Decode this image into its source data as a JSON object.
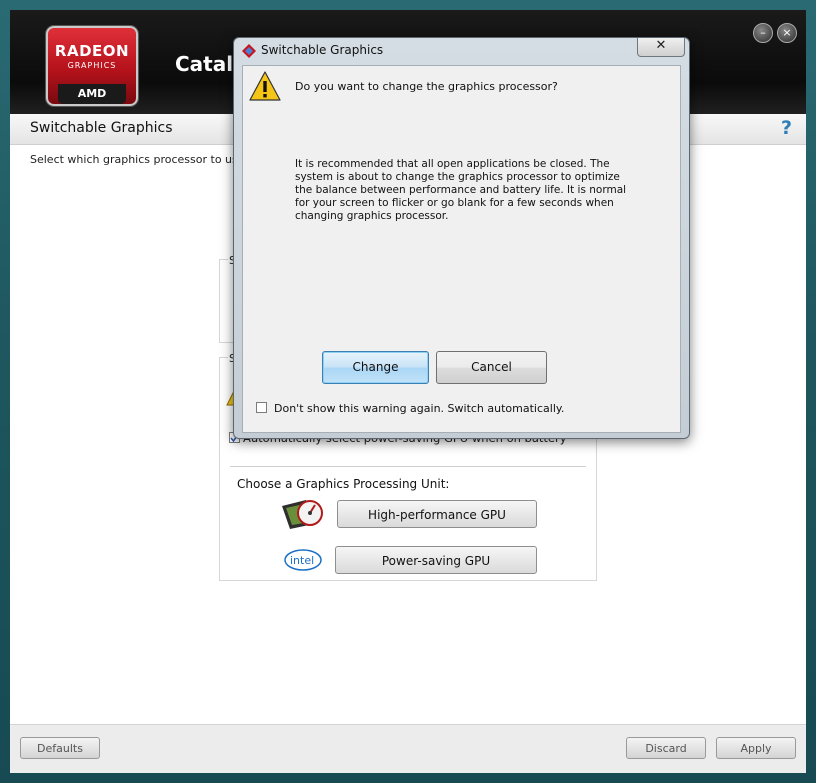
{
  "header": {
    "logo": {
      "line1": "RADEON",
      "line2": "GRAPHICS",
      "line3": "AMD"
    },
    "app_title": "Cataly",
    "minimize_glyph": "–",
    "close_glyph": "×"
  },
  "page": {
    "title": "Switchable Graphics",
    "help_glyph": "?",
    "description": "Select which graphics processor to use in",
    "group1_label": "S",
    "group2_label": "S",
    "auto_select_label": "Automatically select power-saving GPU when on battery",
    "auto_select_checked": true,
    "choose_label": "Choose a Graphics Processing Unit:",
    "high_perf_button": "High-performance GPU",
    "power_saving_button": "Power-saving GPU",
    "intel_logo_text": "intel"
  },
  "footer": {
    "defaults_label": "Defaults",
    "discard_label": "Discard",
    "apply_label": "Apply"
  },
  "dialog": {
    "title": "Switchable Graphics",
    "close_glyph": "✕",
    "question": "Do you want to change the graphics processor?",
    "message": "It is recommended that all open applications be closed. The system is about to change the graphics processor to optimize the balance between performance and battery life. It is normal for your screen to flicker or go blank for a few seconds when changing graphics processor.",
    "change_label": "Change",
    "cancel_label": "Cancel",
    "dont_show_label": "Don't show this warning again. Switch automatically.",
    "dont_show_checked": false
  },
  "colors": {
    "frame": "#1f5860",
    "amd_red": "#c8141e",
    "help_blue": "#2e7fb8",
    "dialog_accent": "#3c7fb1"
  }
}
